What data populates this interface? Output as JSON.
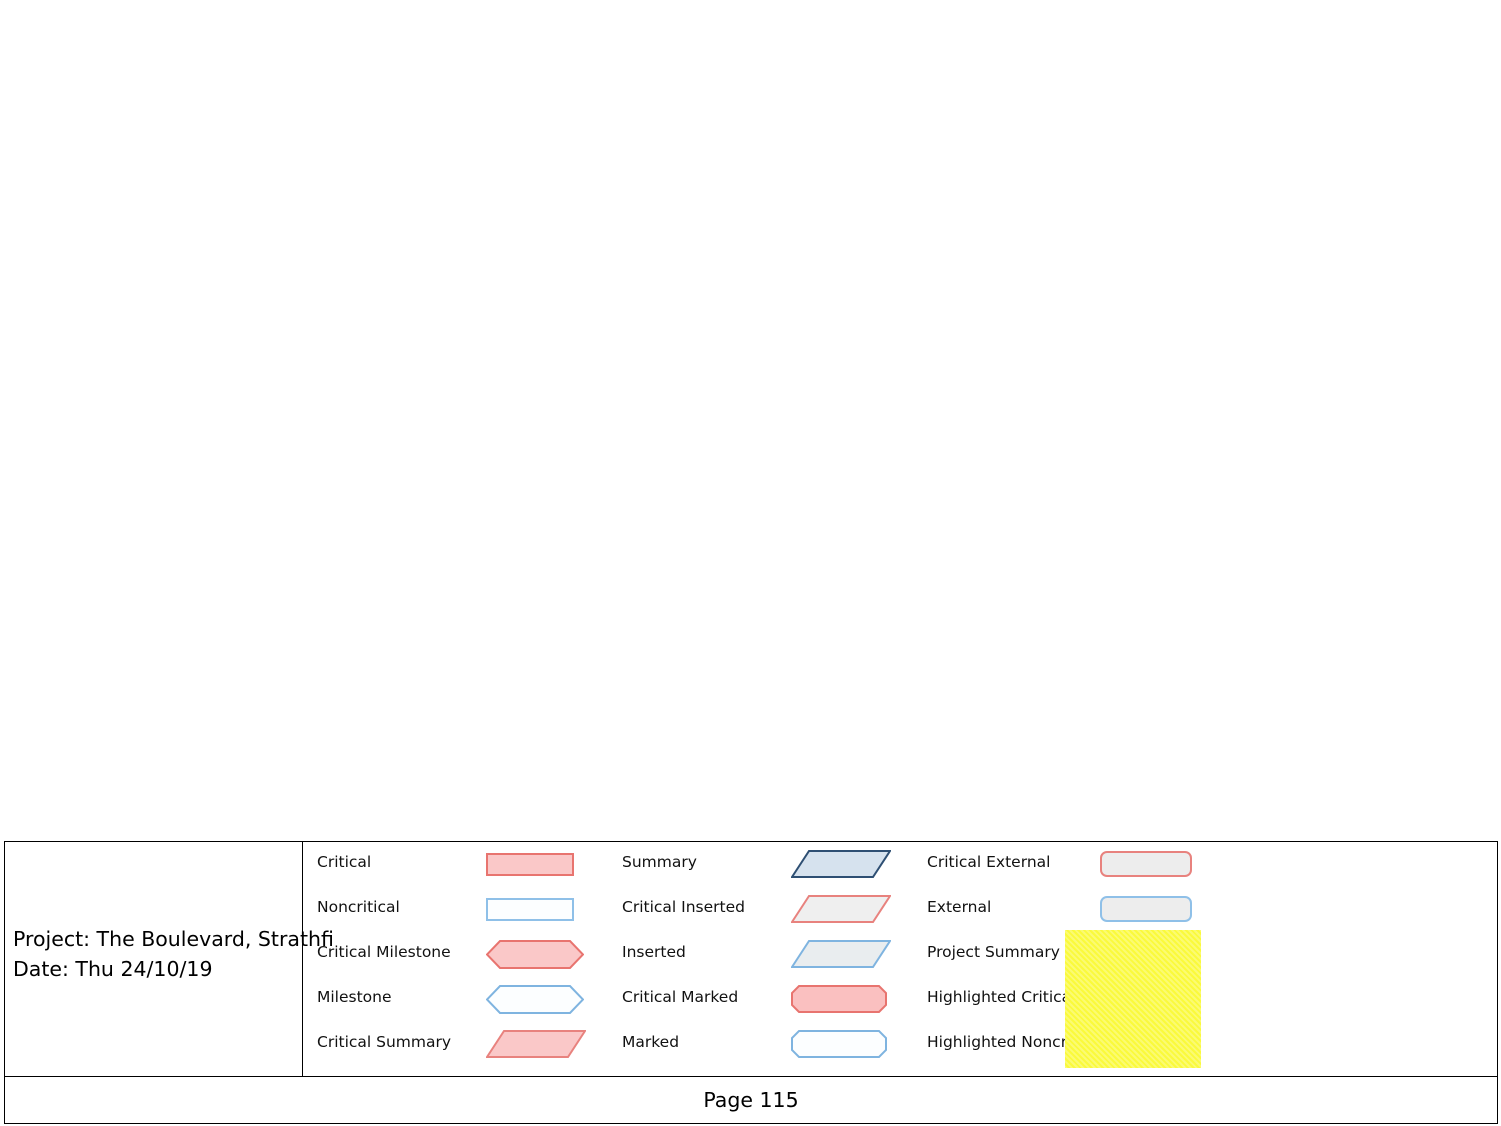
{
  "document": {
    "project_line": "Project: The Boulevard, Strathfi",
    "date_line": "Date: Thu 24/10/19",
    "page_label": "Page 115"
  },
  "legend": {
    "columns": [
      {
        "name": "column-1",
        "rows": [
          {
            "label": "Critical",
            "shape": "bar-critical"
          },
          {
            "label": "Noncritical",
            "shape": "bar-noncritical"
          },
          {
            "label": "Critical Milestone",
            "shape": "hexagon-critical"
          },
          {
            "label": "Milestone",
            "shape": "hexagon-noncritical"
          },
          {
            "label": "Critical Summary",
            "shape": "parallelogram-critical"
          }
        ]
      },
      {
        "name": "column-2",
        "rows": [
          {
            "label": "Summary",
            "shape": "parallelogram-summary"
          },
          {
            "label": "Critical Inserted",
            "shape": "parallelogram-critical-inserted"
          },
          {
            "label": "Inserted",
            "shape": "parallelogram-inserted"
          },
          {
            "label": "Critical Marked",
            "shape": "octagon-critical"
          },
          {
            "label": "Marked",
            "shape": "octagon-noncritical"
          }
        ]
      },
      {
        "name": "column-3",
        "rows": [
          {
            "label": "Critical External",
            "shape": "rounded-bar-critical-external"
          },
          {
            "label": "External",
            "shape": "rounded-bar-external"
          },
          {
            "label": "Project Summary",
            "shape": "project-summary-bracket"
          },
          {
            "label": "Highlighted Critical",
            "shape": "highlighted-critical-bracket"
          },
          {
            "label": "Highlighted Noncritical",
            "shape": "highlighted-noncritical-outline"
          }
        ]
      }
    ]
  },
  "colors": {
    "critical_fill": "#FAC8C8",
    "critical_border": "#E8746F",
    "noncritical_fill": "#FCFEFF",
    "noncritical_border": "#8FC0E8",
    "summary_fill": "#D6E2EE",
    "summary_border": "#2E4F73",
    "inserted_fill": "#ECECEC",
    "external_fill": "#EDEDED",
    "project_summary_border": "#C8794F",
    "highlight_overlay": "#FAFA3C",
    "highlighted_noncritical_border": "#7FB0B0",
    "frame_border": "#000000",
    "text": "#000000"
  }
}
